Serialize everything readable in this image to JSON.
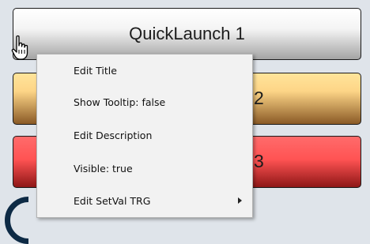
{
  "buttons": [
    {
      "label": "QuickLaunch 1"
    },
    {
      "label": "2"
    },
    {
      "label": "3"
    }
  ],
  "context_menu": {
    "items": [
      {
        "label": "Edit Title"
      },
      {
        "label": "Show Tooltip: false"
      },
      {
        "label": "Edit Description"
      },
      {
        "label": "Visible: true"
      },
      {
        "label": "Edit SetVal TRG",
        "has_submenu": true
      }
    ]
  },
  "colors": {
    "button1": "#f4f4f4",
    "button2": "#fdd587",
    "button3": "#ff5353",
    "menu_bg": "#f2f2f2",
    "background": "#dfe4ea"
  },
  "icons": {
    "cursor": "hand-pointer-icon",
    "submenu": "chevron-right-icon"
  }
}
